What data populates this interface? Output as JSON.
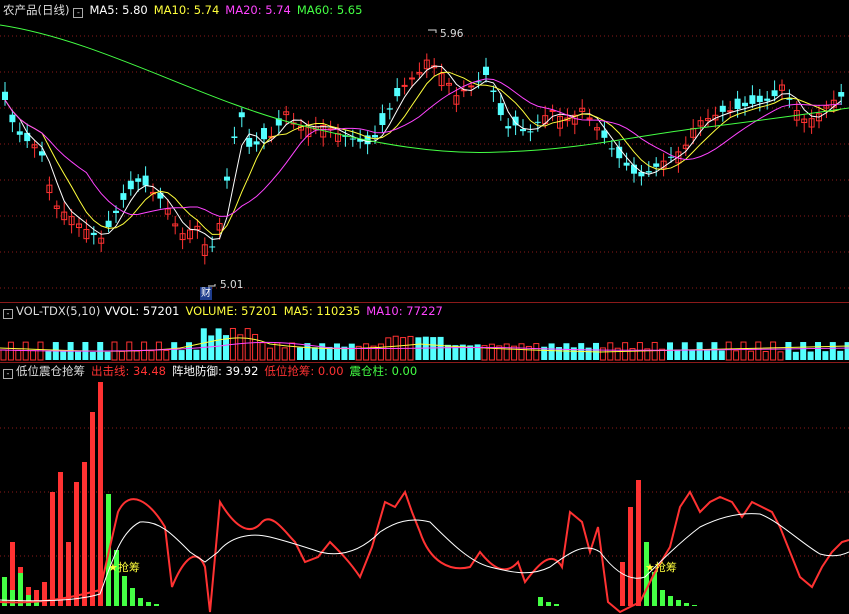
{
  "price_pane": {
    "title": "农产品(日线)",
    "ma5": {
      "label": "MA5:",
      "value": "5.80",
      "color": "#ffffff"
    },
    "ma10": {
      "label": "MA10:",
      "value": "5.74",
      "color": "#ffff3c"
    },
    "ma20": {
      "label": "MA20:",
      "value": "5.74",
      "color": "#ff44ff"
    },
    "ma60": {
      "label": "MA60:",
      "value": "5.65",
      "color": "#44ff44"
    },
    "high_marker": "5.96",
    "low_marker": "5.01",
    "event_badge": "财"
  },
  "volume_pane": {
    "title": "VOL-TDX(5,10)",
    "vvol": "VVOL: 57201",
    "volume": "VOLUME: 57201",
    "ma5": "MA5: 110235",
    "ma10": "MA10: 77227",
    "colors": {
      "vvol": "#ffffff",
      "volume": "#ffff3c",
      "ma5": "#ffff3c",
      "ma10": "#ff44ff"
    }
  },
  "indicator_pane": {
    "title": "低位震仓抢筹",
    "items": [
      {
        "text": "出击线: 34.48",
        "color": "#ff3232"
      },
      {
        "text": "阵地防御: 39.92",
        "color": "#ffffff"
      },
      {
        "text": "低位抢筹: 0.00",
        "color": "#ff3232"
      },
      {
        "text": "震仓柱: 0.00",
        "color": "#44ff44"
      }
    ],
    "signal_label": "★抢筹"
  },
  "colors": {
    "up": "#ff3232",
    "down": "#54ffff",
    "grid": "#8b1a1a",
    "background": "#000000"
  }
}
